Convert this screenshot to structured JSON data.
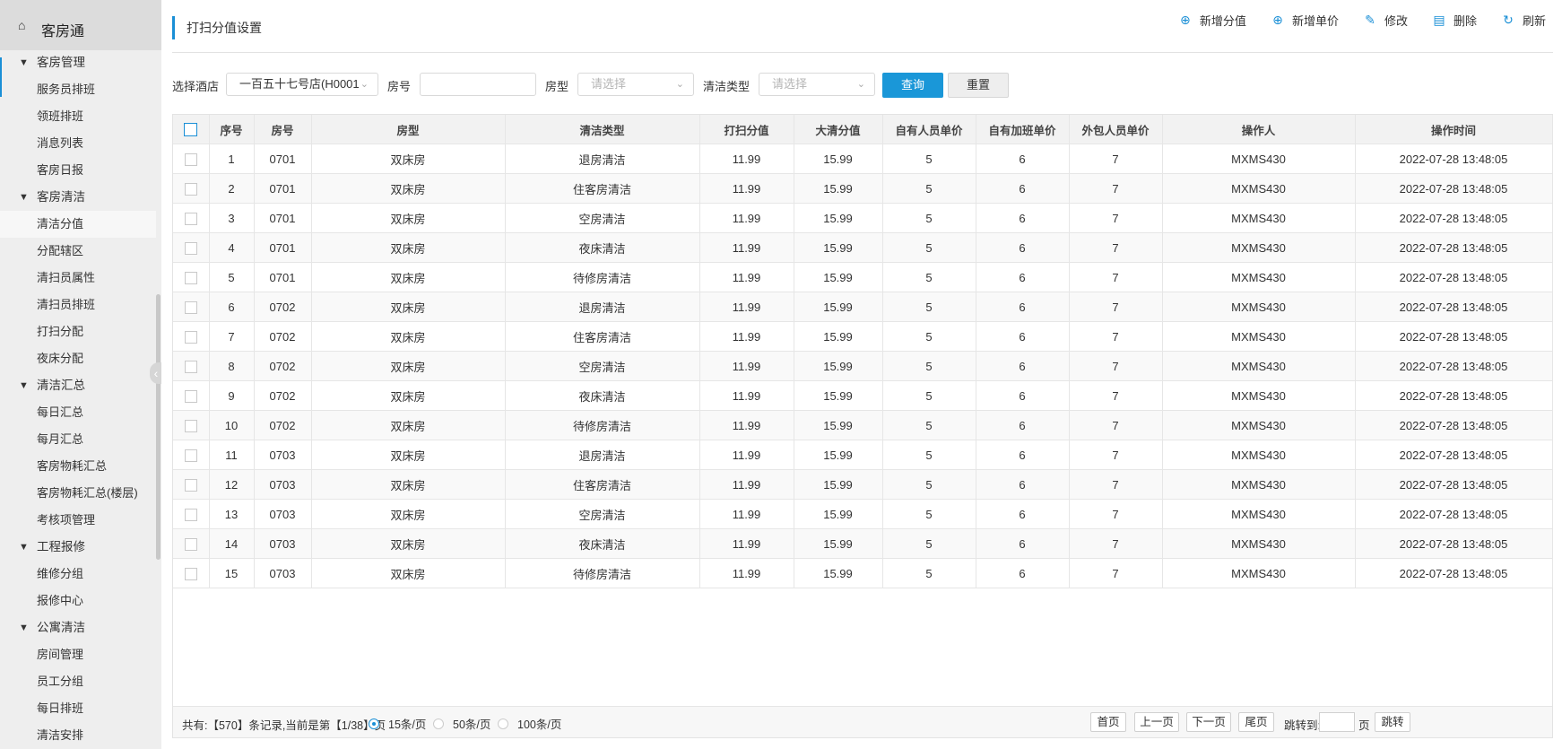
{
  "app": {
    "home_icon": "home-icon",
    "title": "客房通"
  },
  "sidebar": {
    "rows": [
      {
        "type": "group",
        "label": "客房管理"
      },
      {
        "type": "item",
        "label": "服务员排班"
      },
      {
        "type": "item",
        "label": "领班排班"
      },
      {
        "type": "item",
        "label": "消息列表"
      },
      {
        "type": "item",
        "label": "客房日报"
      },
      {
        "type": "group",
        "label": "客房清洁"
      },
      {
        "type": "item",
        "label": "清洁分值",
        "active": true
      },
      {
        "type": "item",
        "label": "分配辖区"
      },
      {
        "type": "item",
        "label": "清扫员属性"
      },
      {
        "type": "item",
        "label": "清扫员排班"
      },
      {
        "type": "item",
        "label": "打扫分配"
      },
      {
        "type": "item",
        "label": "夜床分配"
      },
      {
        "type": "group",
        "label": "清洁汇总"
      },
      {
        "type": "item",
        "label": "每日汇总"
      },
      {
        "type": "item",
        "label": "每月汇总"
      },
      {
        "type": "item",
        "label": "客房物耗汇总"
      },
      {
        "type": "item",
        "label": "客房物耗汇总(楼层)"
      },
      {
        "type": "item",
        "label": "考核项管理"
      },
      {
        "type": "group",
        "label": "工程报修"
      },
      {
        "type": "item",
        "label": "维修分组"
      },
      {
        "type": "item",
        "label": "报修中心"
      },
      {
        "type": "group",
        "label": "公寓清洁"
      },
      {
        "type": "item",
        "label": "房间管理"
      },
      {
        "type": "item",
        "label": "员工分组"
      },
      {
        "type": "item",
        "label": "每日排班"
      },
      {
        "type": "item",
        "label": "清洁安排"
      }
    ]
  },
  "page": {
    "title": "打扫分值设置"
  },
  "toolbar": {
    "add_score": {
      "label": "新增分值",
      "icon": "plus-circle-icon"
    },
    "add_price": {
      "label": "新增单价",
      "icon": "plus-circle-icon"
    },
    "edit": {
      "label": "修改",
      "icon": "pencil-icon"
    },
    "delete": {
      "label": "删除",
      "icon": "trash-icon"
    },
    "refresh": {
      "label": "刷新",
      "icon": "refresh-icon"
    }
  },
  "filters": {
    "hotel_label": "选择酒店",
    "hotel_value": "一百五十七号店(H0001",
    "room_label": "房号",
    "room_value": "",
    "room_type_label": "房型",
    "room_type_placeholder": "请选择",
    "clean_type_label": "清洁类型",
    "clean_type_placeholder": "请选择",
    "query_label": "查询",
    "reset_label": "重置"
  },
  "table": {
    "columns": [
      "序号",
      "房号",
      "房型",
      "清洁类型",
      "打扫分值",
      "大清分值",
      "自有人员单价",
      "自有加班单价",
      "外包人员单价",
      "操作人",
      "操作时间"
    ],
    "rows": [
      [
        "1",
        "0701",
        "双床房",
        "退房清洁",
        "11.99",
        "15.99",
        "5",
        "6",
        "7",
        "MXMS430",
        "2022-07-28 13:48:05"
      ],
      [
        "2",
        "0701",
        "双床房",
        "住客房清洁",
        "11.99",
        "15.99",
        "5",
        "6",
        "7",
        "MXMS430",
        "2022-07-28 13:48:05"
      ],
      [
        "3",
        "0701",
        "双床房",
        "空房清洁",
        "11.99",
        "15.99",
        "5",
        "6",
        "7",
        "MXMS430",
        "2022-07-28 13:48:05"
      ],
      [
        "4",
        "0701",
        "双床房",
        "夜床清洁",
        "11.99",
        "15.99",
        "5",
        "6",
        "7",
        "MXMS430",
        "2022-07-28 13:48:05"
      ],
      [
        "5",
        "0701",
        "双床房",
        "待修房清洁",
        "11.99",
        "15.99",
        "5",
        "6",
        "7",
        "MXMS430",
        "2022-07-28 13:48:05"
      ],
      [
        "6",
        "0702",
        "双床房",
        "退房清洁",
        "11.99",
        "15.99",
        "5",
        "6",
        "7",
        "MXMS430",
        "2022-07-28 13:48:05"
      ],
      [
        "7",
        "0702",
        "双床房",
        "住客房清洁",
        "11.99",
        "15.99",
        "5",
        "6",
        "7",
        "MXMS430",
        "2022-07-28 13:48:05"
      ],
      [
        "8",
        "0702",
        "双床房",
        "空房清洁",
        "11.99",
        "15.99",
        "5",
        "6",
        "7",
        "MXMS430",
        "2022-07-28 13:48:05"
      ],
      [
        "9",
        "0702",
        "双床房",
        "夜床清洁",
        "11.99",
        "15.99",
        "5",
        "6",
        "7",
        "MXMS430",
        "2022-07-28 13:48:05"
      ],
      [
        "10",
        "0702",
        "双床房",
        "待修房清洁",
        "11.99",
        "15.99",
        "5",
        "6",
        "7",
        "MXMS430",
        "2022-07-28 13:48:05"
      ],
      [
        "11",
        "0703",
        "双床房",
        "退房清洁",
        "11.99",
        "15.99",
        "5",
        "6",
        "7",
        "MXMS430",
        "2022-07-28 13:48:05"
      ],
      [
        "12",
        "0703",
        "双床房",
        "住客房清洁",
        "11.99",
        "15.99",
        "5",
        "6",
        "7",
        "MXMS430",
        "2022-07-28 13:48:05"
      ],
      [
        "13",
        "0703",
        "双床房",
        "空房清洁",
        "11.99",
        "15.99",
        "5",
        "6",
        "7",
        "MXMS430",
        "2022-07-28 13:48:05"
      ],
      [
        "14",
        "0703",
        "双床房",
        "夜床清洁",
        "11.99",
        "15.99",
        "5",
        "6",
        "7",
        "MXMS430",
        "2022-07-28 13:48:05"
      ],
      [
        "15",
        "0703",
        "双床房",
        "待修房清洁",
        "11.99",
        "15.99",
        "5",
        "6",
        "7",
        "MXMS430",
        "2022-07-28 13:48:05"
      ]
    ]
  },
  "pager": {
    "info": "共有:【570】条记录,当前是第【1/38】页",
    "size_15": "15条/页",
    "size_50": "50条/页",
    "size_100": "100条/页",
    "selected_size": "15条/页",
    "first": "首页",
    "prev": "上一页",
    "next": "下一页",
    "last": "尾页",
    "jump_to": "跳转到:",
    "page_unit": "页",
    "jump": "跳转"
  },
  "colors": {
    "accent": "#1a97d8",
    "sidebar_bg": "#eeeeee",
    "header_bg": "#f2f2f2"
  }
}
